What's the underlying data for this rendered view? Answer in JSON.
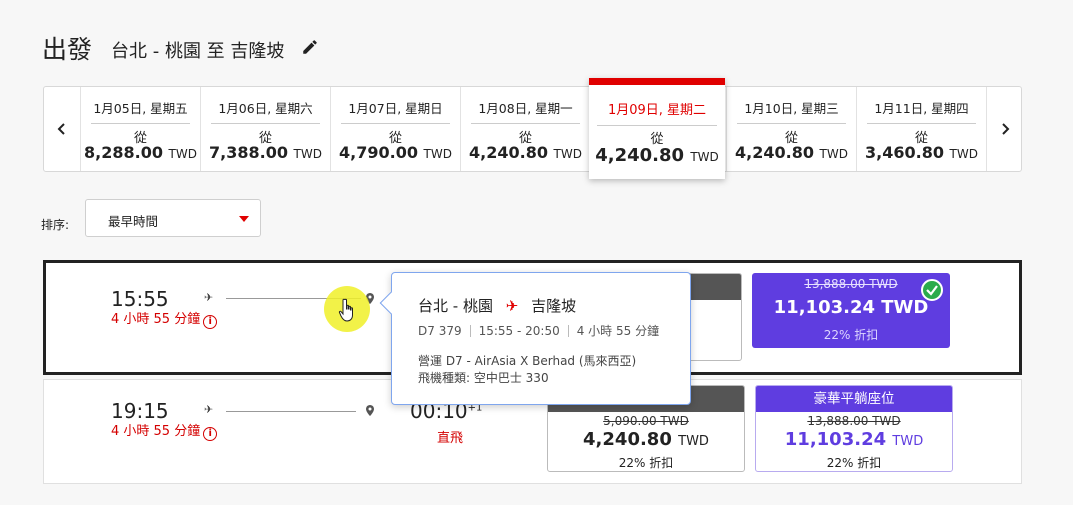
{
  "header": {
    "title": "出發",
    "route": "台北 - 桃園 至 吉隆坡",
    "edit_icon": "pencil-icon"
  },
  "dates": [
    {
      "date": "1月05日, 星期五",
      "from": "從",
      "price": "8,288.00",
      "currency": "TWD"
    },
    {
      "date": "1月06日, 星期六",
      "from": "從",
      "price": "7,388.00",
      "currency": "TWD"
    },
    {
      "date": "1月07日, 星期日",
      "from": "從",
      "price": "4,790.00",
      "currency": "TWD"
    },
    {
      "date": "1月08日, 星期一",
      "from": "從",
      "price": "4,240.80",
      "currency": "TWD"
    },
    {
      "date": "1月09日, 星期二",
      "from": "從",
      "price": "4,240.80",
      "currency": "TWD",
      "selected": true
    },
    {
      "date": "1月10日, 星期三",
      "from": "從",
      "price": "4,240.80",
      "currency": "TWD"
    },
    {
      "date": "1月11日, 星期四",
      "from": "從",
      "price": "3,460.80",
      "currency": "TWD"
    }
  ],
  "sort": {
    "label": "排序:",
    "value": "最早時間"
  },
  "flights": [
    {
      "depart": "15:55",
      "duration": "4 小時 55 分鐘",
      "fares": [
        {
          "old": "13,888.00 TWD",
          "price": "11,103.24 TWD",
          "discount": "22% 折扣"
        }
      ]
    },
    {
      "depart": "19:15",
      "duration": "4 小時 55 分鐘",
      "arrive": "00:10",
      "arrive_suffix": "+1",
      "stops": "直飛",
      "fares": [
        {
          "old": "5,090.00 TWD",
          "price": "4,240.80",
          "currency": "TWD",
          "discount": "22% 折扣"
        },
        {
          "header": "豪華平躺座位",
          "old": "13,888.00 TWD",
          "price": "11,103.24",
          "currency": "TWD",
          "discount": "22% 折扣"
        }
      ]
    }
  ],
  "tooltip": {
    "origin": "台北 - 桃園",
    "destination": "吉隆坡",
    "flight_no": "D7 379",
    "times": "15:55 - 20:50",
    "duration": "4 小時 55 分鐘",
    "operator": "營運 D7 - AirAsia X Berhad (馬來西亞)",
    "aircraft": "飛機種類: 空中巴士 330"
  },
  "colors": {
    "accent_red": "#e00000",
    "purple": "#5f3de0",
    "success": "#2bab4c"
  }
}
